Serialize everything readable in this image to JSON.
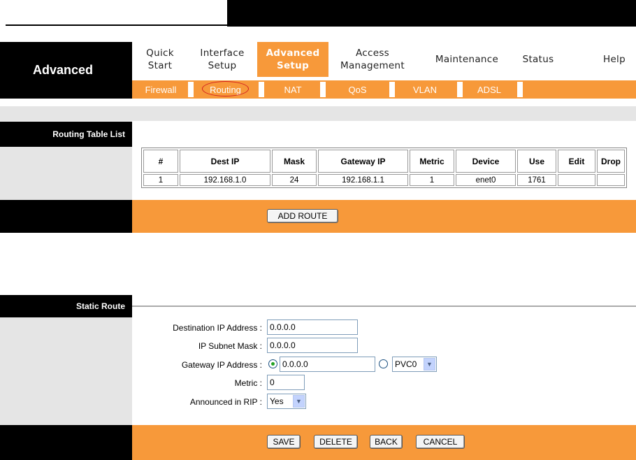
{
  "nav": {
    "section_title": "Advanced",
    "menu": [
      {
        "label": "Quick\nStart"
      },
      {
        "label": "Interface\nSetup"
      },
      {
        "label": "Advanced\nSetup"
      },
      {
        "label": "Access\nManagement"
      },
      {
        "label": "Maintenance"
      },
      {
        "label": "Status"
      },
      {
        "label": "Help"
      }
    ],
    "submenu": [
      "Firewall",
      "Routing",
      "NAT",
      "QoS",
      "VLAN",
      "ADSL"
    ],
    "active_menu": "Advanced Setup",
    "active_submenu": "Routing"
  },
  "routing_table": {
    "section_title": "Routing Table List",
    "columns": [
      "#",
      "Dest IP",
      "Mask",
      "Gateway IP",
      "Metric",
      "Device",
      "Use",
      "Edit",
      "Drop"
    ],
    "rows": [
      [
        "1",
        "192.168.1.0",
        "24",
        "192.168.1.1",
        "1",
        "enet0",
        "1761",
        "",
        ""
      ]
    ],
    "add_button": "ADD ROUTE"
  },
  "static_route": {
    "section_title": "Static Route",
    "dest_ip_label": "Destination IP Address :",
    "dest_ip_value": "0.0.0.0",
    "subnet_label": "IP Subnet Mask :",
    "subnet_value": "0.0.0.0",
    "gateway_label": "Gateway IP Address :",
    "gateway_value": "0.0.0.0",
    "gateway_option_selected": "ip",
    "pvc_value": "PVC0",
    "metric_label": "Metric :",
    "metric_value": "0",
    "rip_label": "Announced in RIP :",
    "rip_value": "Yes"
  },
  "actions": {
    "save": "SAVE",
    "delete": "DELETE",
    "back": "BACK",
    "cancel": "CANCEL"
  },
  "colors": {
    "accent": "#f7993a",
    "header_black": "#000000",
    "panel_grey": "#e5e5e5",
    "highlight_oval": "#d21f1f"
  }
}
